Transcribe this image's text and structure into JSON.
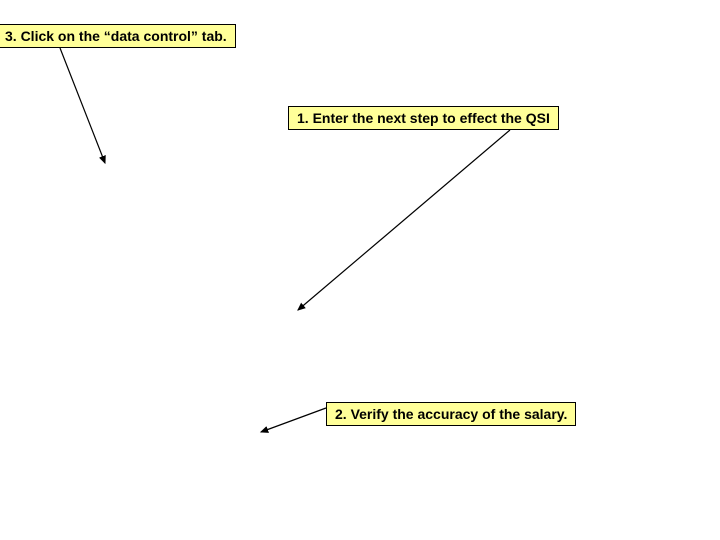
{
  "callouts": {
    "step3": "3.  Click on the “data control” tab.",
    "step1": "1. Enter the next step to effect the QSI",
    "step2": "2. Verify the accuracy of the salary."
  },
  "colors": {
    "callout_bg": "#ffff99",
    "border": "#000000"
  }
}
